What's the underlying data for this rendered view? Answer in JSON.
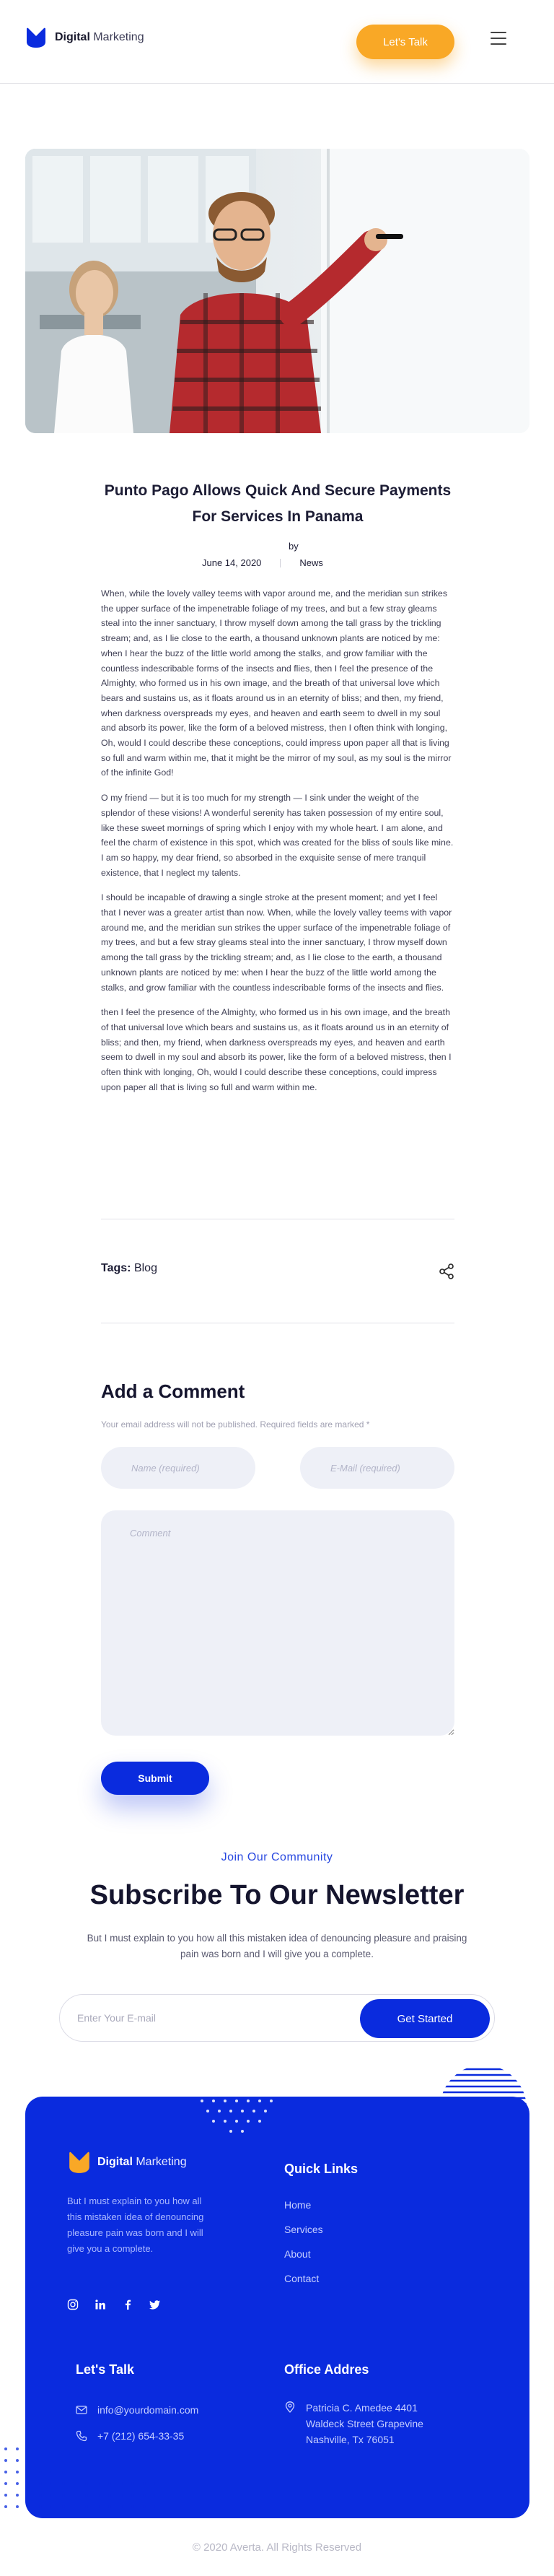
{
  "header": {
    "brand_bold": "Digital",
    "brand_light": " Marketing",
    "cta_label": "Let's Talk",
    "menu_icon": "hamburger-icon"
  },
  "post": {
    "title": "Punto Pago Allows Quick And Secure Payments For Services In Panama",
    "by_label": "by",
    "date": "June 14, 2020",
    "category": "News",
    "paragraphs": [
      "When, while the lovely valley teems with vapor around me, and the meridian sun strikes the upper surface of the impenetrable foliage of my trees, and but a few stray gleams steal into the inner sanctuary, I throw myself down among the tall grass by the trickling stream; and, as I lie close to the earth, a thousand unknown plants are noticed by me: when I hear the buzz of the little world among the stalks, and grow familiar with the countless indescribable forms of the insects and flies, then I feel the presence of the Almighty, who formed us in his own image, and the breath of that universal love which bears and sustains us, as it floats around us in an eternity of bliss; and then, my friend, when darkness overspreads my eyes, and heaven and earth seem to dwell in my soul and absorb its power, like the form of a beloved mistress, then I often think with longing, Oh, would I could describe these conceptions, could impress upon paper all that is living so full and warm within me, that it might be the mirror of my soul, as my soul is the mirror of the infinite God!",
      "O my friend — but it is too much for my strength — I sink under the weight of the splendor of these visions! A wonderful serenity has taken possession of my entire soul, like these sweet mornings of spring which I enjoy with my whole heart. I am alone, and feel the charm of existence in this spot, which was created for the bliss of souls like mine. I am so happy, my dear friend, so absorbed in the exquisite sense of mere tranquil existence, that I neglect my talents.",
      "I should be incapable of drawing a single stroke at the present moment; and yet I feel that I never was a greater artist than now. When, while the lovely valley teems with vapor around me, and the meridian sun strikes the upper surface of the impenetrable foliage of my trees, and but a few stray gleams steal into the inner sanctuary, I throw myself down among the tall grass by the trickling stream; and, as I lie close to the earth, a thousand unknown plants are noticed by me: when I hear the buzz of the little world among the stalks, and grow familiar with the countless indescribable forms of the insects and flies.",
      "then I feel the presence of the Almighty, who formed us in his own image, and the breath of that universal love which bears and sustains us, as it floats around us in an eternity of bliss; and then, my friend, when darkness overspreads my eyes, and heaven and earth seem to dwell in my soul and absorb its power, like the form of a beloved mistress, then I often think with longing, Oh, would I could describe these conceptions, could impress upon paper all that is living so full and warm within me."
    ],
    "tags_label": "Tags:",
    "tag": "Blog",
    "share_icon": "share-icon"
  },
  "comment_form": {
    "title": "Add a Comment",
    "note": "Your email address will not be published. Required fields are marked *",
    "name_placeholder": "Name (required)",
    "email_placeholder": "E-Mail (required)",
    "comment_placeholder": "Comment",
    "submit_label": "Submit"
  },
  "newsletter": {
    "kicker": "Join Our Community",
    "title": "Subscribe To Our Newsletter",
    "description": "But I must explain to you how all this mistaken idea of denouncing pleasure and praising pain was born and I will give you a complete.",
    "input_placeholder": "Enter Your E-mail",
    "button_label": "Get Started"
  },
  "footer": {
    "brand_bold": "Digital",
    "brand_light": " Marketing",
    "description": "But I must explain to you how all this mistaken idea of denouncing pleasure pain was born and I will give you a complete.",
    "social_icons": [
      "instagram-icon",
      "linkedin-icon",
      "facebook-icon",
      "twitter-icon"
    ],
    "quick_links_title": "Quick Links",
    "quick_links": [
      "Home",
      "Services",
      "About",
      "Contact"
    ],
    "talk_title": "Let's Talk",
    "email": "info@yourdomain.com",
    "phone": "+7 (212) 654-33-35",
    "office_title": "Office Addres",
    "address": "Patricia C. Amedee 4401 Waldeck Street Grapevine Nashville, Tx 76051"
  },
  "copyright": "© 2020 Averta. All Rights Reserved",
  "colors": {
    "brand_blue": "#0a2bde",
    "accent_orange": "#f9a826",
    "text_dark": "#15152e"
  }
}
